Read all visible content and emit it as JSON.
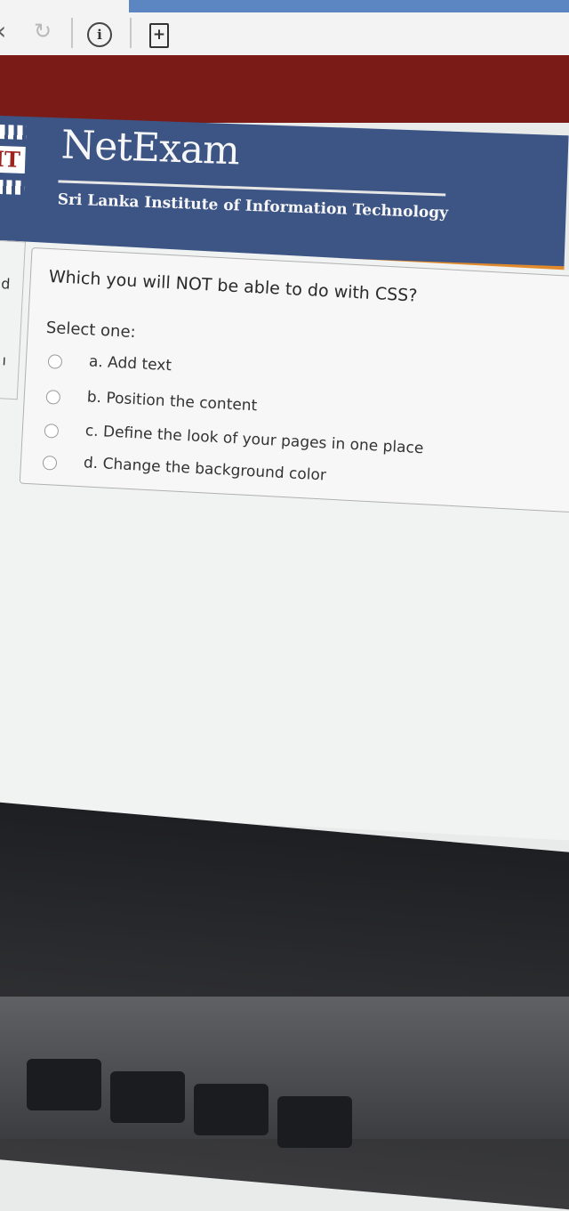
{
  "browser": {
    "back_icon": "chevron-left-icon",
    "reload_icon": "reload-icon",
    "info_label": "i",
    "bookmark_label": "+"
  },
  "header": {
    "brand": "NetExam",
    "logo_text": "IT",
    "subtitle": "Sri Lanka Institute of Information Technology"
  },
  "sidebar_fragments": [
    "d",
    "ı"
  ],
  "question": {
    "text": "Which you will NOT be able to do with CSS?",
    "prompt": "Select one:",
    "options": [
      {
        "label": "a. Add text",
        "selected": false
      },
      {
        "label": "b. Position the content",
        "selected": false
      },
      {
        "label": "c. Define the look of your pages in one place",
        "selected": false
      },
      {
        "label": "d. Change the background color",
        "selected": false
      }
    ]
  },
  "colors": {
    "header_bg": "#3d5585",
    "accent_orange": "#e08a2c",
    "top_band": "#7a1b17"
  }
}
